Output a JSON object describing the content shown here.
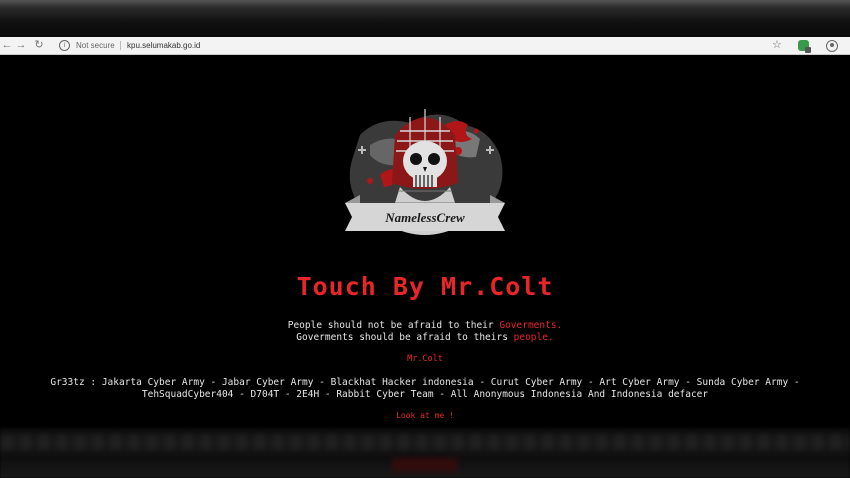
{
  "browser": {
    "back_icon": "back-arrow-icon",
    "forward_icon": "forward-arrow-icon",
    "reload_icon": "reload-icon",
    "security_label": "Not secure",
    "url": "kpu.selumakab.go.id",
    "bookmark_icon": "star-icon",
    "extension_icon": "extension-icon",
    "profile_icon": "profile-icon"
  },
  "page": {
    "logo_banner_text": "NamelessCrew",
    "headline": "Touch By Mr.Colt",
    "message_line1_prefix": "People should not be afraid to their ",
    "message_line1_highlight": "Goverments.",
    "message_line2_prefix": "Goverments should be afraid to theirs ",
    "message_line2_highlight": "people.",
    "author": "Mr.Colt",
    "greets_line1": "Gr33tz : Jakarta Cyber Army - Jabar Cyber Army - Blackhat Hacker indonesia - Curut Cyber Army - Art Cyber Army - Sunda Cyber Army -",
    "greets_line2": "TehSquadCyber404 - D704T - 2E4H - Rabbit Cyber Team - All Anonymous Indonesia And Indonesia defacer",
    "link_text": "Look at me !"
  },
  "colors": {
    "background": "#000000",
    "accent_red": "#e8262a",
    "text": "#e6e6e6"
  }
}
